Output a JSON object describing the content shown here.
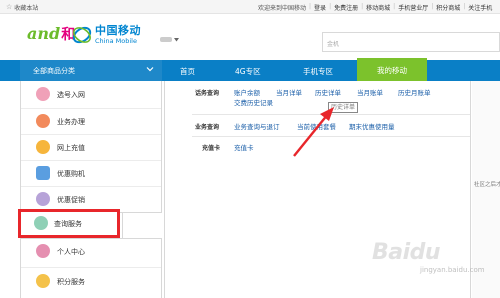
{
  "topbar": {
    "favorite": "收藏本站",
    "welcome": "欢迎来到中国移动",
    "login": "登录",
    "register": "免费注册",
    "links": [
      "移动商城",
      "手机营业厅",
      "积分商城",
      "关注手机"
    ]
  },
  "header": {
    "and_logo": "and",
    "he_logo": "和",
    "brand_cn": "中国移动",
    "brand_en": "China Mobile",
    "search_placeholder": "金机"
  },
  "nav": {
    "category_title": "全部商品分类",
    "items": [
      "首页",
      "4G专区",
      "手机专区",
      "我的移动"
    ]
  },
  "sidebar": {
    "items": [
      {
        "label": "选号入网",
        "color": "#f0a1b8"
      },
      {
        "label": "业务办理",
        "color": "#f28a5c"
      },
      {
        "label": "网上充值",
        "color": "#f6b53c"
      },
      {
        "label": "优惠购机",
        "color": "#5a9ee0"
      },
      {
        "label": "优惠促销",
        "color": "#b7a3d8"
      },
      {
        "label": "查询服务",
        "color": "#8fd0b6"
      },
      {
        "label": "个人中心",
        "color": "#e58fb0"
      },
      {
        "label": "积分服务",
        "color": "#f4c24a"
      }
    ]
  },
  "panel": {
    "sections": [
      {
        "label": "话务查询",
        "links": [
          "账户余额",
          "当月详单",
          "历史详单",
          "当月账单",
          "历史月账单",
          "交费历史记录"
        ]
      },
      {
        "label": "业务查询",
        "links": [
          "业务查询与退订",
          "当前使用套餐",
          "期末优惠使用量"
        ]
      },
      {
        "label": "充值卡",
        "links": [
          "充值卡"
        ]
      }
    ],
    "tooltip": "历史详单"
  },
  "edge_text": "社区之后才前",
  "watermark": {
    "main": "Baidu",
    "sub": "jingyan.baidu.com"
  },
  "colors": {
    "nav_blue": "#0a7fc6",
    "active_green": "#7cc22c",
    "highlight_red": "#e8262b",
    "arrow_red": "#e8262b"
  }
}
